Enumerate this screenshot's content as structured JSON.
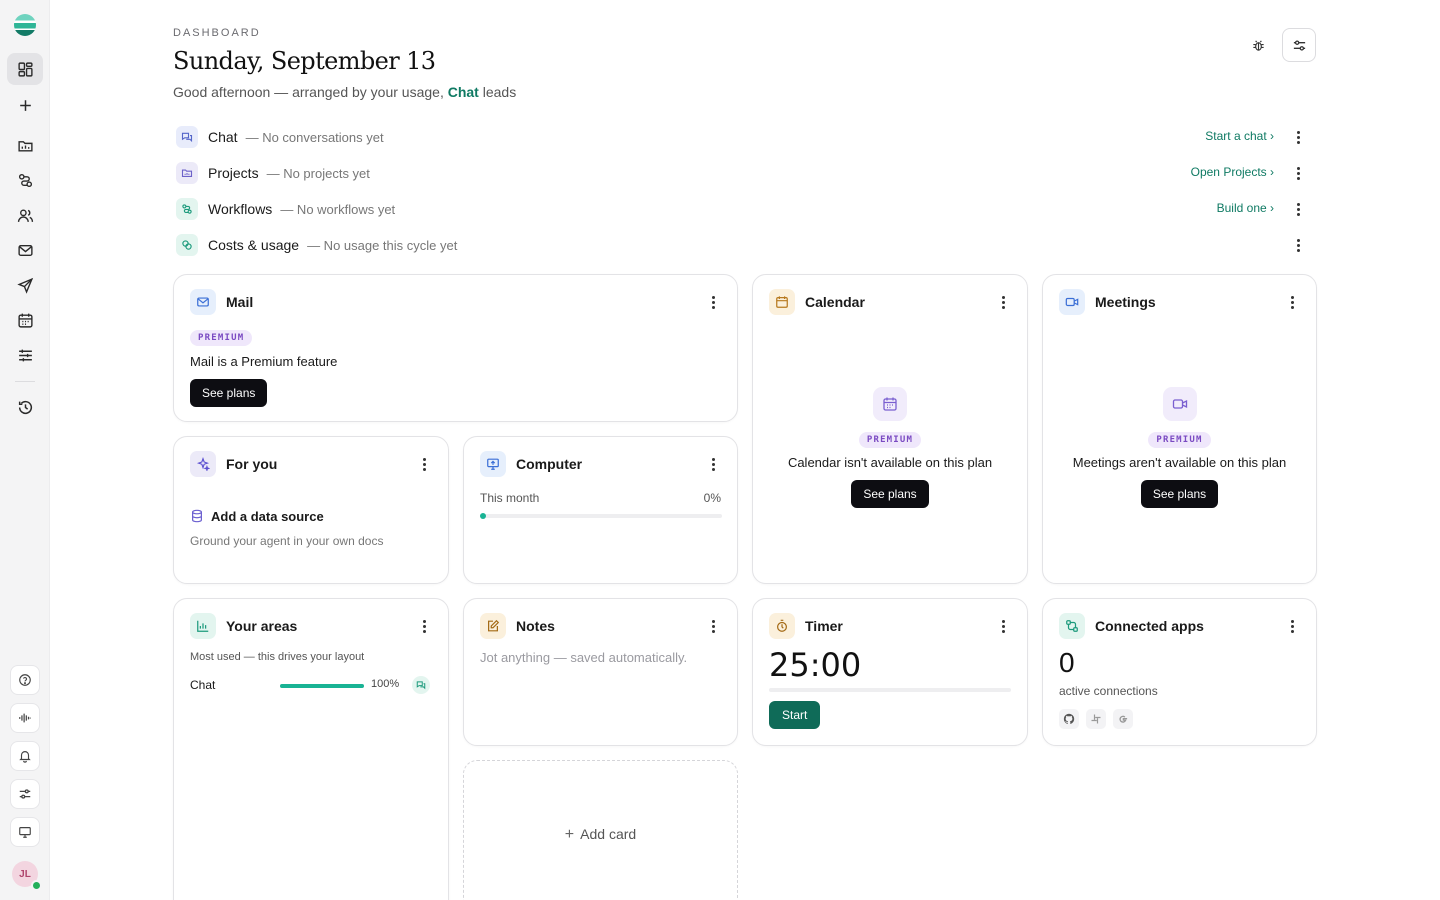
{
  "header": {
    "eyebrow": "DASHBOARD",
    "title": "Sunday, September 13",
    "subtitle_prefix": "Good afternoon — arranged by your usage, ",
    "subtitle_highlight": "Chat",
    "subtitle_suffix": " leads"
  },
  "usage_rows": [
    {
      "name": "Chat",
      "status": "— No conversations yet",
      "action": "Start a chat ›",
      "icon": "chat-icon"
    },
    {
      "name": "Projects",
      "status": "— No projects yet",
      "action": "Open Projects ›",
      "icon": "folder-icon"
    },
    {
      "name": "Workflows",
      "status": "— No workflows yet",
      "action": "Build one ›",
      "icon": "workflow-icon"
    },
    {
      "name": "Costs & usage",
      "status": "— No usage this cycle yet",
      "action": "",
      "icon": "coins-icon"
    }
  ],
  "cards": {
    "mail": {
      "title": "Mail",
      "badge": "PREMIUM",
      "text": "Mail is a Premium feature",
      "button": "See plans"
    },
    "calendar": {
      "title": "Calendar",
      "badge": "PREMIUM",
      "text": "Calendar isn't available on this plan",
      "button": "See plans"
    },
    "meetings": {
      "title": "Meetings",
      "badge": "PREMIUM",
      "text": "Meetings aren't available on this plan",
      "button": "See plans"
    },
    "for_you": {
      "title": "For you",
      "item_title": "Add a data source",
      "item_desc": "Ground your agent in your own docs"
    },
    "computer": {
      "title": "Computer",
      "label": "This month",
      "percent_label": "0%",
      "progress": 0
    },
    "areas": {
      "title": "Your areas",
      "desc": "Most used — this drives your layout",
      "rows": [
        {
          "name": "Chat",
          "percent_label": "100%",
          "progress": 1.0
        }
      ]
    },
    "notes": {
      "title": "Notes",
      "placeholder": "Jot anything — saved automatically."
    },
    "timer": {
      "title": "Timer",
      "time": "25:00",
      "button": "Start",
      "progress": 0
    },
    "connected": {
      "title": "Connected apps",
      "count": "0",
      "label": "active connections",
      "apps": [
        "github-icon",
        "slack-icon",
        "google-icon"
      ]
    },
    "add_card": {
      "label": "Add card"
    }
  },
  "sidebar": {
    "avatar_initials": "JL",
    "nav": [
      "dashboard-icon",
      "plus-icon",
      "folder-icon",
      "workflow-icon",
      "users-icon",
      "mail-icon",
      "send-icon",
      "calendar-icon",
      "sliders-icon",
      "history-icon"
    ],
    "bottom": [
      "help-icon",
      "voice-icon",
      "bell-icon",
      "settings-sliders-icon",
      "monitor-icon"
    ]
  },
  "colors": {
    "accent": "#0f7a63",
    "premium": "#7a4ac2",
    "progress": "#19b394",
    "dark_button": "#0d0d12"
  }
}
